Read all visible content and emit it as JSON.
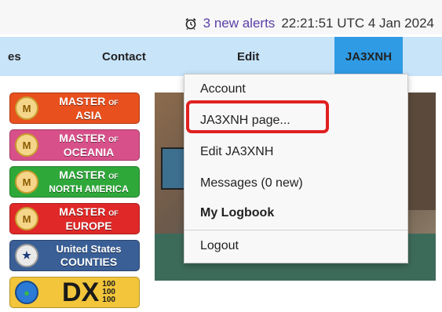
{
  "status": {
    "alerts_text": "3 new alerts",
    "time_text": "22:21:51 UTC 4 Jan 2024"
  },
  "nav": {
    "partial_item": "es",
    "contact": "Contact",
    "edit": "Edit",
    "user": "JA3XNH"
  },
  "badges": [
    {
      "line1": "MASTER",
      "of": "OF",
      "line2": "ASIA",
      "color": "#e8501e"
    },
    {
      "line1": "MASTER",
      "of": "OF",
      "line2": "OCEANIA",
      "color": "#d8508a"
    },
    {
      "line1": "MASTER",
      "of": "OF",
      "line2": "NORTH AMERICA",
      "color": "#2fa83a"
    },
    {
      "line1": "MASTER",
      "of": "OF",
      "line2": "EUROPE",
      "color": "#e02828"
    },
    {
      "line1": "United States",
      "line2": "COUNTIES",
      "color": "#3a5f96"
    },
    {
      "big": "DX",
      "nums": [
        "100",
        "100",
        "100"
      ],
      "color": "#f2c53a"
    }
  ],
  "dropdown": {
    "items": [
      "Account",
      "JA3XNH page...",
      "Edit JA3XNH",
      "Messages (0 new)",
      "My Logbook",
      "Logout"
    ]
  },
  "colors": {
    "nav_bg": "#c8e4f9",
    "nav_active": "#2f9be5",
    "highlight": "#e02020"
  }
}
